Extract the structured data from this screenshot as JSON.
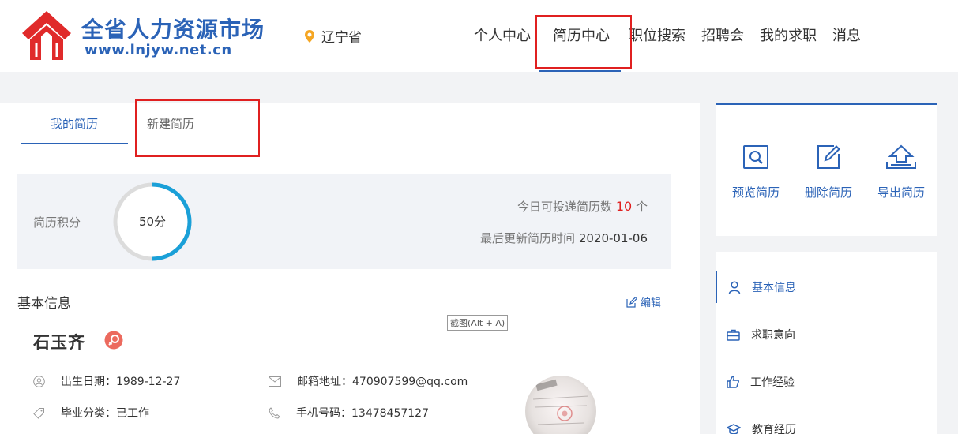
{
  "header": {
    "site_name": "全省人力资源市场",
    "site_url": "www.lnjyw.net.cn",
    "location": "辽宁省",
    "nav": [
      {
        "label": "个人中心"
      },
      {
        "label": "简历中心"
      },
      {
        "label": "职位搜索"
      },
      {
        "label": "招聘会"
      },
      {
        "label": "我的求职"
      },
      {
        "label": "消息"
      }
    ],
    "active_nav": "简历中心"
  },
  "tabs": {
    "my_resume": "我的简历",
    "new_resume": "新建简历"
  },
  "score": {
    "label": "简历积分",
    "value_text": "50分",
    "progress_fraction": 0.5,
    "deliver_prefix": "今日可投递简历数",
    "deliver_count": "10",
    "deliver_unit": "个",
    "updated_label": "最后更新简历时间",
    "updated_value": "2020-01-06"
  },
  "basic": {
    "title": "基本信息",
    "edit": "编辑",
    "tooltip": "截图(Alt + A)",
    "name": "石玉齐",
    "birth": "出生日期：1989-12-27",
    "grad": "毕业分类：已工作",
    "email": "邮箱地址：470907599@qq.com",
    "phone": "手机号码：13478457127"
  },
  "actions": {
    "preview": "预览简历",
    "delete": "删除简历",
    "export": "导出简历"
  },
  "side_nav": {
    "basic": "基本信息",
    "intent": "求职意向",
    "work": "工作经验",
    "edu": "教育经历"
  },
  "colors": {
    "brand": "#2b63b7",
    "highlight": "#e02020",
    "ring": "#1aa0d8",
    "gender": "#ec6a5e"
  }
}
